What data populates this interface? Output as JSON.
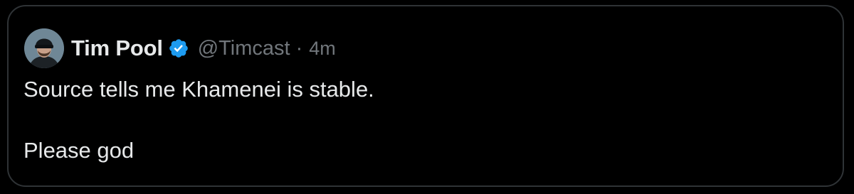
{
  "tweet": {
    "author": {
      "display_name": "Tim Pool",
      "handle": "@Timcast",
      "verified": true,
      "verified_color": "#1d9bf0"
    },
    "separator": "·",
    "timestamp": "4m",
    "lines": [
      "Source tells me Khamenei is stable.",
      "Please god"
    ]
  },
  "colors": {
    "background": "#000000",
    "border": "#2f3336",
    "primary_text": "#e7e9ea",
    "secondary_text": "#71767b"
  }
}
